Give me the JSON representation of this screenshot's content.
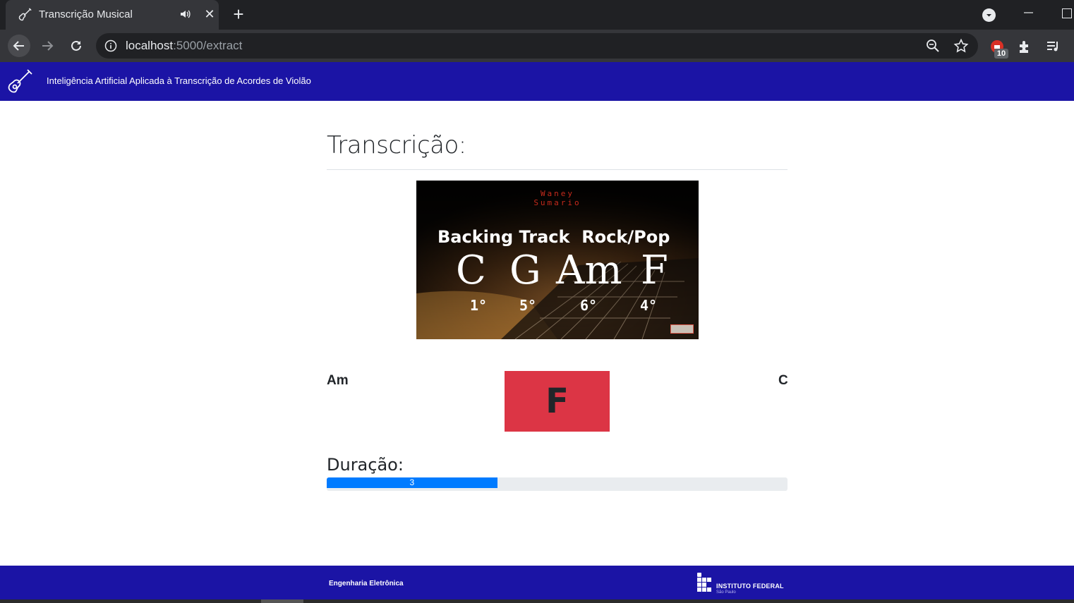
{
  "browser": {
    "tab_title": "Transcrição Musical",
    "url_host": "localhost",
    "url_rest": ":5000/extract",
    "extension_badge": "10"
  },
  "header": {
    "title": "Inteligência Artificial Aplicada à Transcrição de Acordes de Violão"
  },
  "main": {
    "title": "Transcrição:",
    "video": {
      "watermark_line1": "Waney",
      "watermark_line2": "Sumario",
      "headline": "Backing Track  Rock/Pop",
      "chords": [
        "C",
        "G",
        "Am",
        "F"
      ],
      "degrees": [
        "1°",
        "5°",
        "6°",
        "4°"
      ]
    },
    "chords": {
      "previous": "Am",
      "current": "F",
      "next": "C"
    },
    "duration": {
      "label": "Duração:",
      "value": "3",
      "fraction": 0.37
    }
  },
  "footer": {
    "text": "Engenharia Eletrônica",
    "institution": "INSTITUTO FEDERAL",
    "campus": "São Paulo"
  },
  "colors": {
    "header_bg": "#1b14a5",
    "current_chord_bg": "#dc3545",
    "progress_fill": "#007bff"
  }
}
